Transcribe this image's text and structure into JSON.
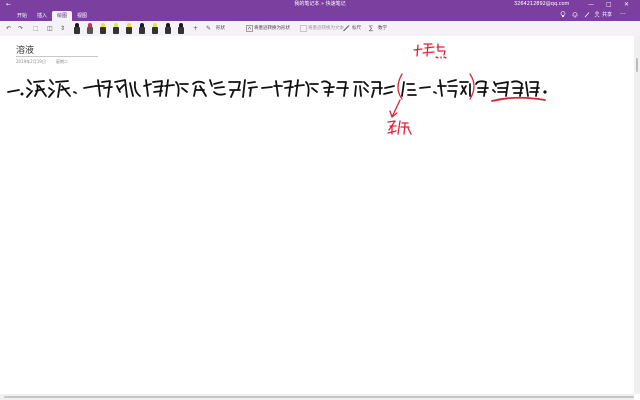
{
  "window": {
    "back_glyph": "←",
    "title": "我的笔记本 » 快速笔记",
    "user": "3264212892@qq.com",
    "minimize_glyph": "—",
    "maximize_glyph": "□",
    "close_glyph": "✕"
  },
  "tabs": [
    {
      "label": "开始"
    },
    {
      "label": "插入"
    },
    {
      "label": "绘图"
    },
    {
      "label": "视图"
    }
  ],
  "active_tab": "绘图",
  "tab_icons": [
    "lightbulb-icon",
    "bell-icon",
    "share-icon",
    "more-icon"
  ],
  "share_label": "共享",
  "ribbon": {
    "undo_glyph": "↶",
    "redo_glyph": "↷",
    "icons": [
      "undo-icon",
      "redo-icon",
      "lasso-select-icon",
      "eraser-icon",
      "insert-space-icon",
      "add-pen-icon",
      "ink-to-shape-icon",
      "ruler-icon",
      "math-icon"
    ],
    "lasso_glyph": "⬚",
    "eraser_glyph": "◫",
    "space_glyph": "⇕",
    "add_glyph": "+",
    "shape_glyph": "✎",
    "shape_label": "形状",
    "ink_to_text_label": "将墨迹转换为形状",
    "ink_to_math_label": "将墨迹转换为文本",
    "ruler_glyph": "📏",
    "ruler_label": "标尺",
    "math_glyph": "∑",
    "math_label": "数学",
    "pens": [
      {
        "color": "#1a1a1a"
      },
      {
        "color": "#e0245e"
      },
      {
        "color": "#f2e21c"
      },
      {
        "color": "#d7e845"
      },
      {
        "color": "#f0df1e"
      },
      {
        "color": "#1a1a1a"
      },
      {
        "color": "#e8e04a"
      },
      {
        "color": "#1a1a1a"
      },
      {
        "color": "#1a1a1a"
      },
      {
        "color": "#1a1a1a"
      },
      {
        "color": "#1a1a1a"
      }
    ]
  },
  "page": {
    "title": "溶液",
    "date": "2019年2月19日",
    "time": "星期二"
  },
  "ink": {
    "black_color": "#111111",
    "red_color": "#d8243c"
  }
}
